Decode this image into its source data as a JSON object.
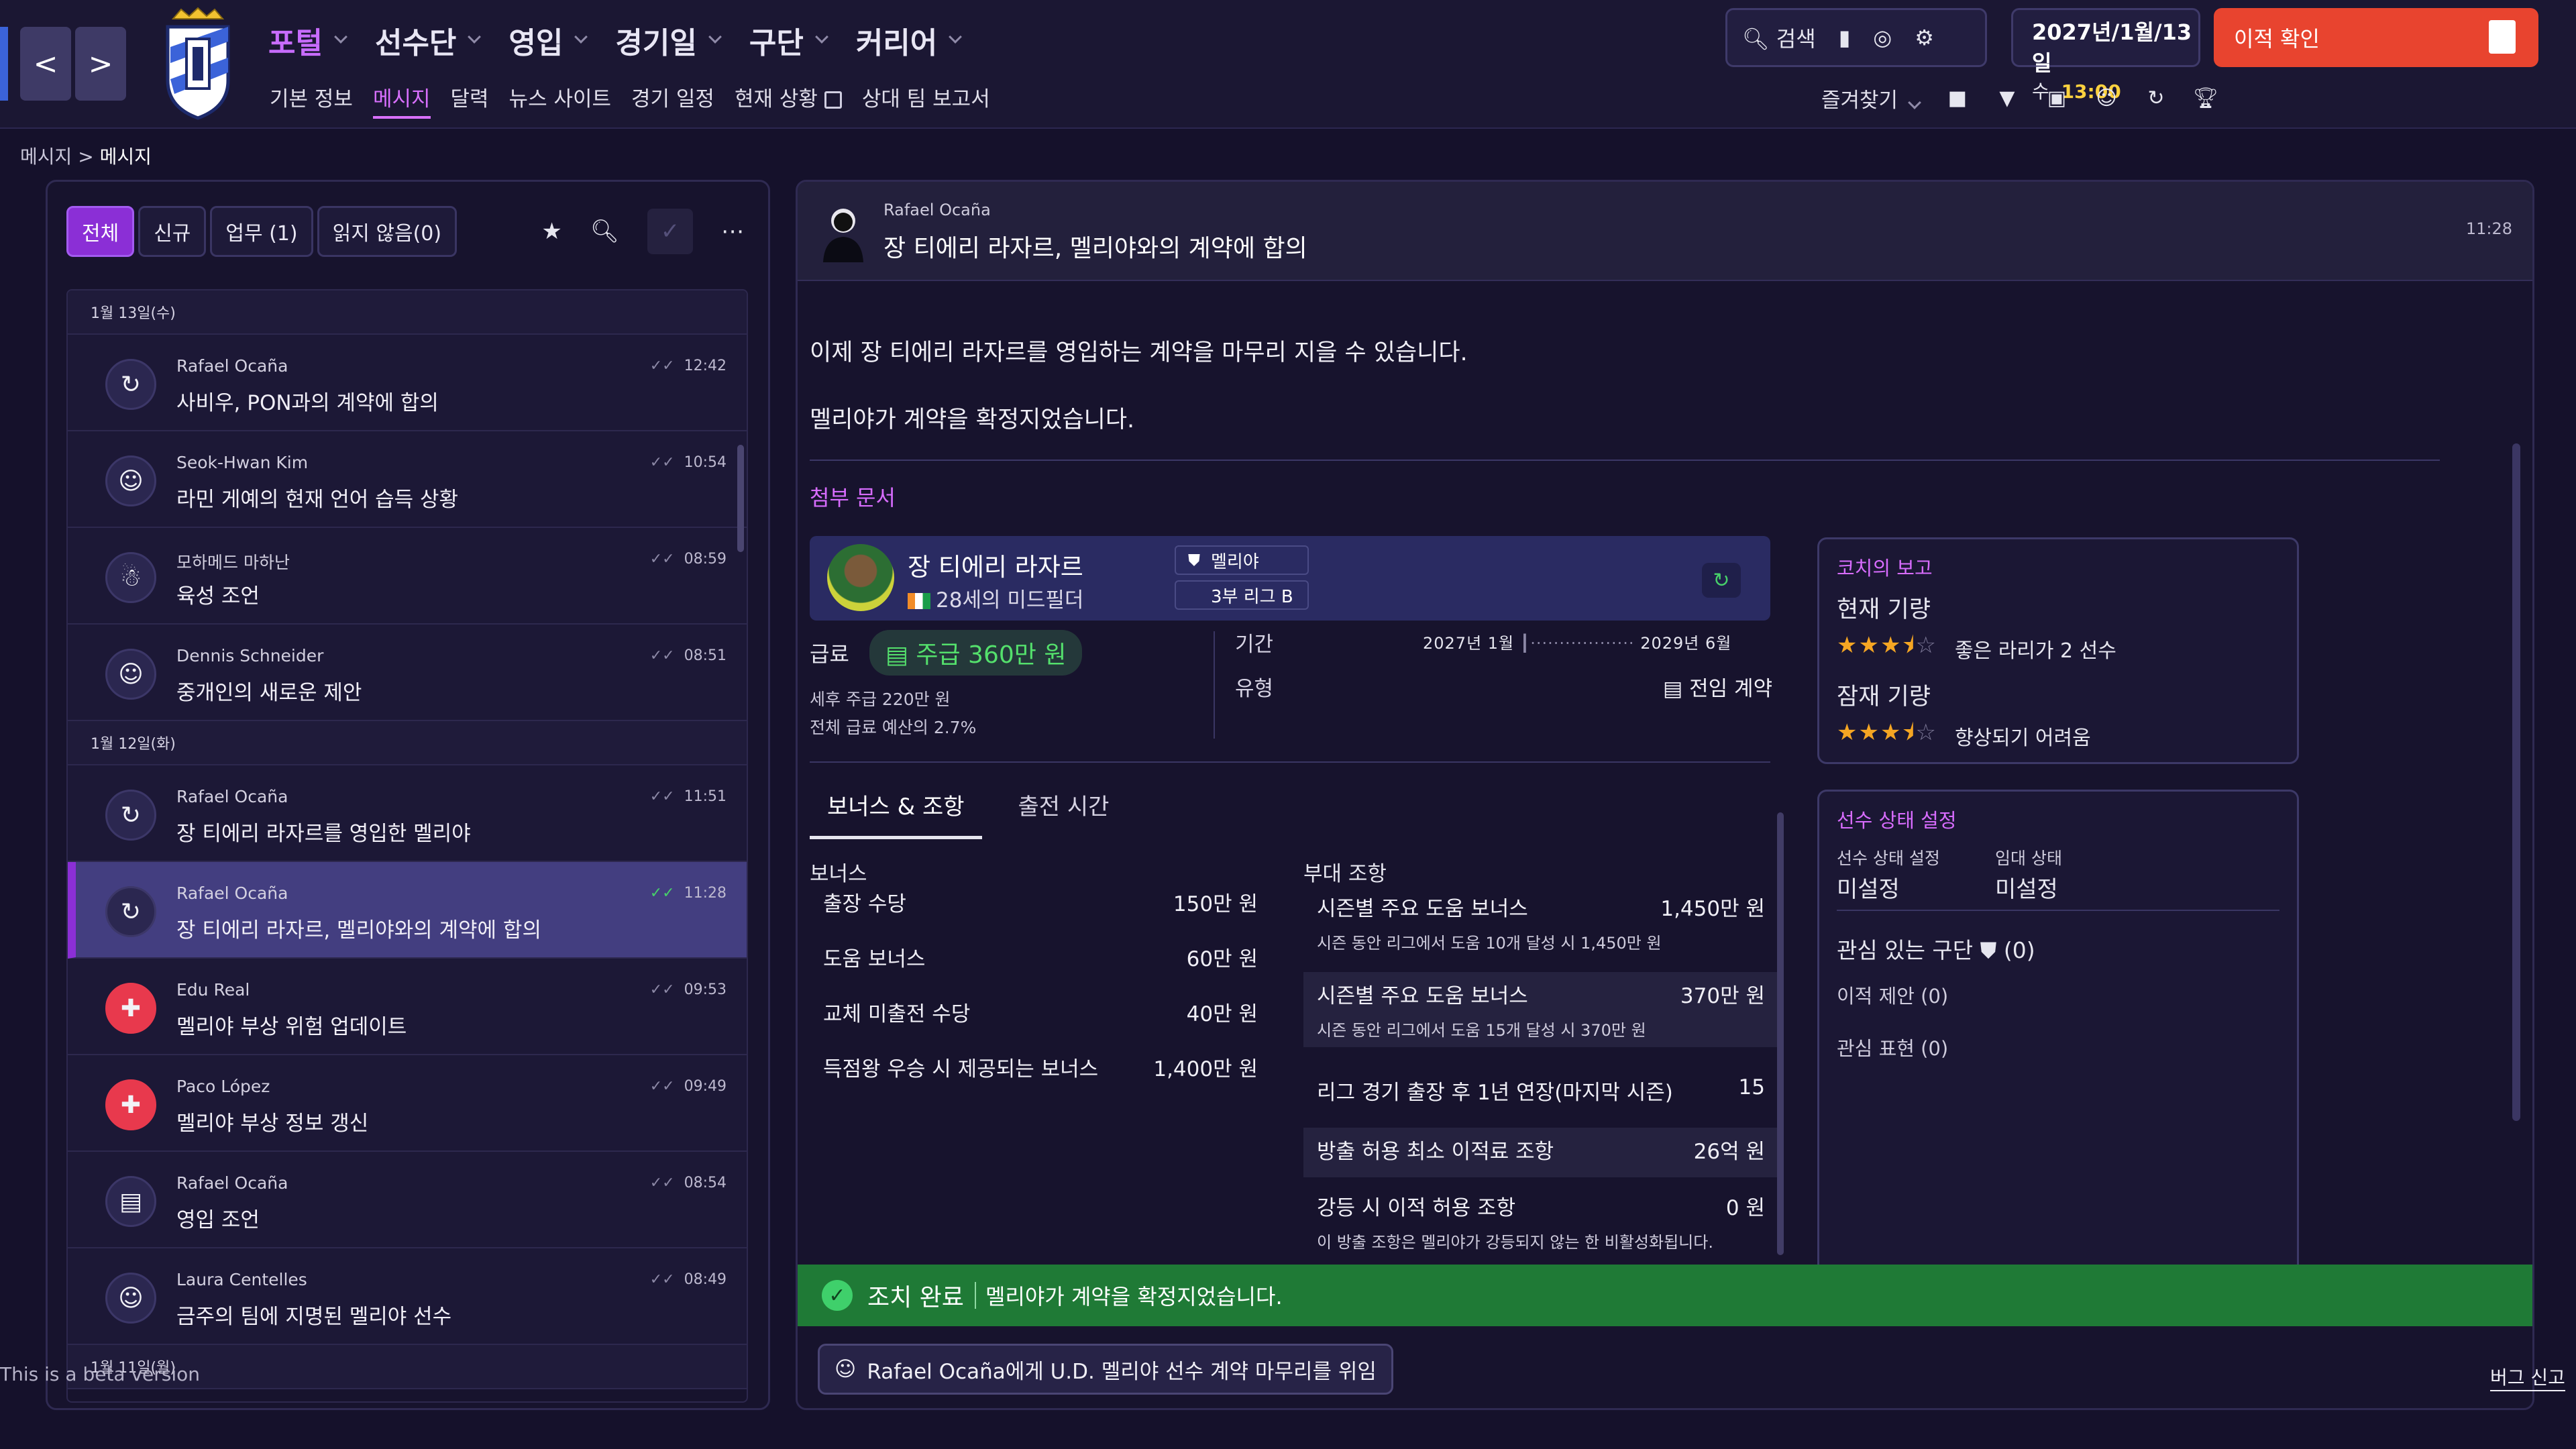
{
  "nav": {
    "back": "<",
    "forward": ">",
    "main": [
      {
        "label": "포털",
        "active": true
      },
      {
        "label": "선수단"
      },
      {
        "label": "영입"
      },
      {
        "label": "경기일"
      },
      {
        "label": "구단"
      },
      {
        "label": "커리어"
      }
    ],
    "sub": [
      "기본 정보",
      "메시지",
      "달력",
      "뉴스 사이트",
      "경기 일정",
      "현재 상황",
      "상대 팀 보고서"
    ],
    "sub_active_index": 1
  },
  "toolbar": {
    "search": "검색"
  },
  "datetime": {
    "date": "2027년/1월/13일",
    "weekday": "수",
    "time": "13:00"
  },
  "transfer_button": "이적 확인",
  "favorites": "즐겨찾기",
  "breadcrumb": {
    "root": "메시지",
    "current": "메시지"
  },
  "filters": [
    {
      "label": "전체",
      "active": true
    },
    {
      "label": "신규"
    },
    {
      "label": "업무 (1)"
    },
    {
      "label": "읽지 않음(0)"
    }
  ],
  "messages": {
    "groups": [
      {
        "date": "1월 13일(수)",
        "items": [
          {
            "from": "Rafael Ocaña",
            "subject": "사비우, PON과의 계약에 합의",
            "time": "12:42",
            "icon": "refresh-icon"
          },
          {
            "from": "Seok-Hwan Kim",
            "subject": "라민 게예의 현재 언어 습득 상황",
            "time": "10:54",
            "icon": "people-icon"
          },
          {
            "from": "모하메드 마하난",
            "subject": "육성 조언",
            "time": "08:59",
            "icon": "group-icon"
          },
          {
            "from": "Dennis Schneider",
            "subject": "중개인의 새로운 제안",
            "time": "08:51",
            "icon": "people-icon"
          }
        ]
      },
      {
        "date": "1월 12일(화)",
        "items": [
          {
            "from": "Rafael Ocaña",
            "subject": "장 티에리 라자르를 영입한 멜리야",
            "time": "11:51",
            "icon": "refresh-icon"
          },
          {
            "from": "Rafael Ocaña",
            "subject": "장 티에리 라자르, 멜리야와의 계약에 합의",
            "time": "11:28",
            "icon": "refresh-icon",
            "selected": true
          },
          {
            "from": "Edu Real",
            "subject": "멜리야 부상 위험 업데이트",
            "time": "09:53",
            "icon": "medical-cross-icon"
          },
          {
            "from": "Paco López",
            "subject": "멜리야 부상 정보 갱신",
            "time": "09:49",
            "icon": "medical-cross-icon"
          },
          {
            "from": "Rafael Ocaña",
            "subject": "영입 조언",
            "time": "08:54",
            "icon": "briefcase-icon"
          },
          {
            "from": "Laura Centelles",
            "subject": "금주의 팀에 지명된 멜리야 선수",
            "time": "08:49",
            "icon": "people-icon"
          }
        ]
      },
      {
        "date": "1월 11일(월)",
        "items": []
      }
    ]
  },
  "detail": {
    "from": "Rafael Ocaña",
    "subject": "장 티에리 라자르, 멜리야와의 계약에 합의",
    "time": "11:28",
    "body1": "이제 장 티에리 라자르를 영입하는 계약을 마무리 지을 수 있습니다.",
    "body2": "멜리야가 계약을 확정지었습니다.",
    "attachments_title": "첨부 문서",
    "player": {
      "name": "장 티에리 라자르",
      "age_position": "28세의 미드필더",
      "club": "멜리야",
      "league": "3부 리그 B"
    },
    "wage_label": "급료",
    "wage_value": "주급 360만 원",
    "wage_after_tax": "세후 주급 220만 원",
    "wage_budget": "전체 급료 예산의 2.7%",
    "period_label": "기간",
    "period_start": "2027년 1월",
    "period_end": "2029년 6월",
    "type_label": "유형",
    "type_value": "전임 계약",
    "tabs": [
      "보너스 & 조항",
      "출전 시간"
    ],
    "bonus_title": "보너스",
    "bonuses": [
      {
        "label": "출장 수당",
        "value": "150만 원"
      },
      {
        "label": "도움 보너스",
        "value": "60만 원"
      },
      {
        "label": "교체 미출전 수당",
        "value": "40만 원"
      },
      {
        "label": "득점왕 우승 시 제공되는 보너스",
        "value": "1,400만 원"
      }
    ],
    "clauses_title": "부대 조항",
    "clauses": [
      {
        "label": "시즌별 주요 도움 보너스",
        "value": "1,450만 원",
        "sub": "시즌 동안 리그에서 도움 10개 달성 시 1,450만 원"
      },
      {
        "label": "시즌별 주요 도움 보너스",
        "value": "370만 원",
        "sub": "시즌 동안 리그에서 도움 15개 달성 시 370만 원"
      },
      {
        "label": "리그 경기 출장 후 1년 연장(마지막 시즌)",
        "value": "15"
      },
      {
        "label": "방출 허용 최소 이적료 조항",
        "value": "26억 원"
      },
      {
        "label": "강등 시 이적 허용 조항",
        "value": "0 원",
        "sub": "이 방출 조항은 멜리야가 강등되지 않는 한 비활성화됩니다."
      }
    ],
    "coach_report": {
      "title": "코치의 보고",
      "current_label": "현재 기량",
      "current_stars": 3.5,
      "current_text": "좋은 라리가 2 선수",
      "potential_label": "잠재 기량",
      "potential_stars": 3.5,
      "potential_text": "향상되기 어려움"
    },
    "status": {
      "title": "선수 상태 설정",
      "status_label": "선수 상태 설정",
      "status_value": "미설정",
      "loan_label": "임대 상태",
      "loan_value": "미설정",
      "interested_label": "관심 있는 구단",
      "interested_count": "(0)",
      "offers": "이적 제안 (0)",
      "interest": "관심 표현 (0)"
    },
    "banner_status": "조치 완료",
    "banner_text": "멜리야가 계약을 확정지었습니다.",
    "delegate": "Rafael Ocaña에게 U.D. 멜리야 선수 계약 마무리를 위임"
  },
  "footer": {
    "beta": "This is a beta version",
    "bug": "버그 신고"
  }
}
